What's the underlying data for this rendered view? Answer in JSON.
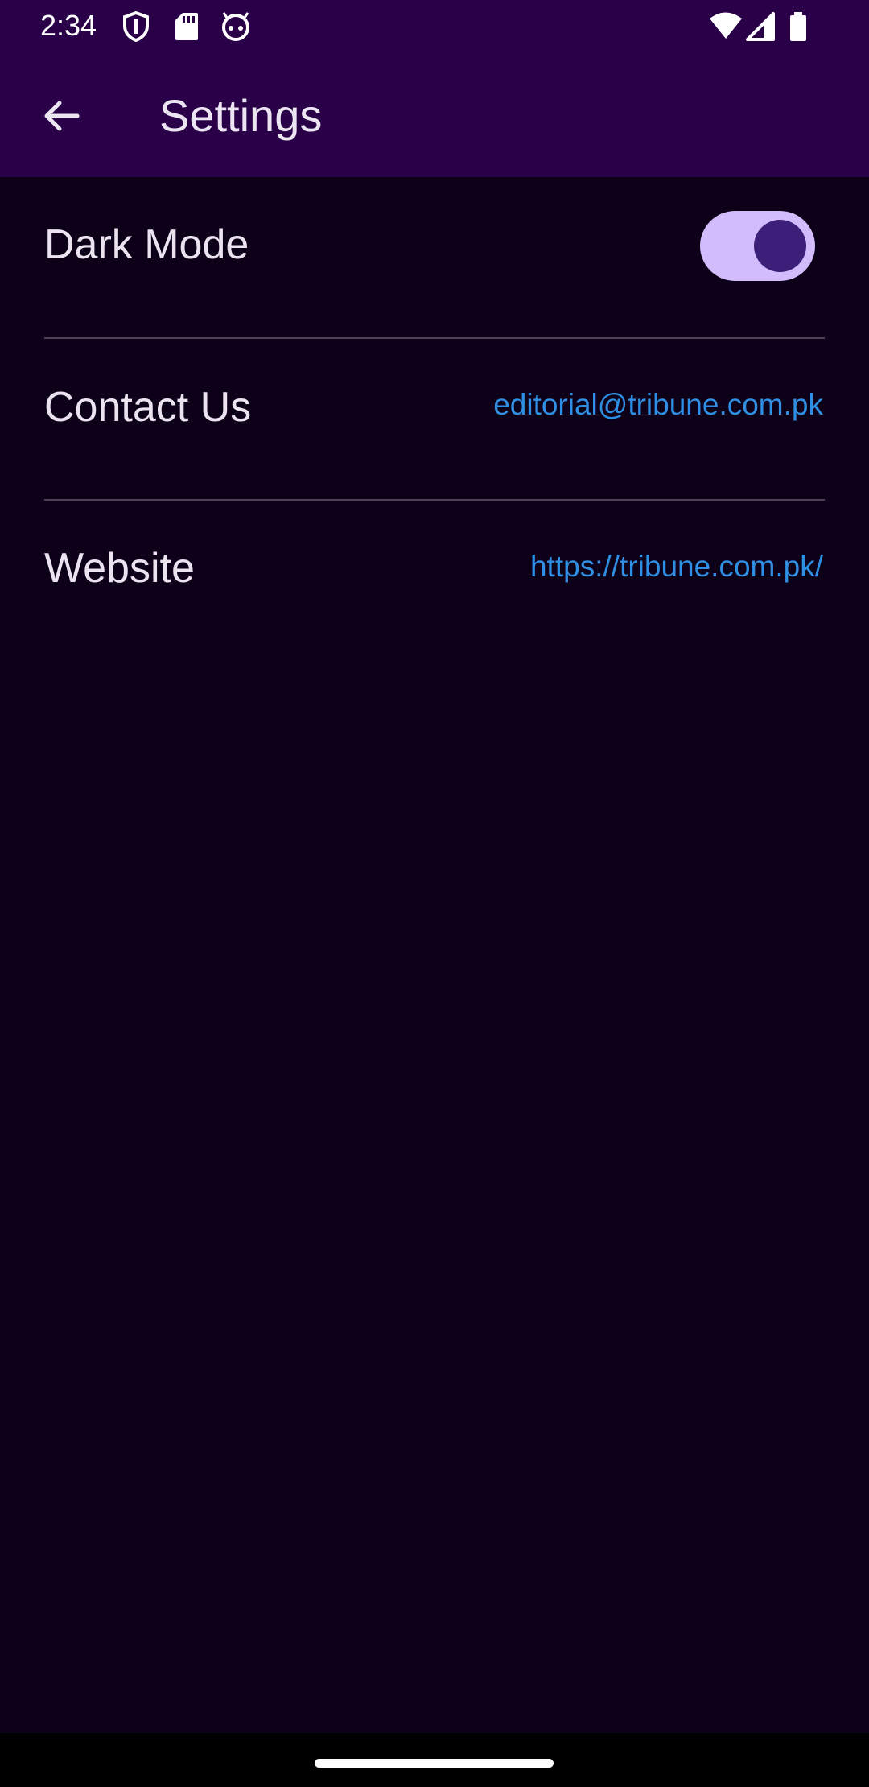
{
  "status_bar": {
    "time": "2:34",
    "left_icons": [
      "shield-icon",
      "sd-card-icon",
      "robot-face-icon"
    ],
    "right_icons": [
      "wifi-icon",
      "signal-icon",
      "battery-icon"
    ]
  },
  "app_bar": {
    "back_icon": "arrow-back-icon",
    "title": "Settings",
    "background": "#2a0148"
  },
  "settings": {
    "dark_mode": {
      "label": "Dark Mode",
      "enabled": true
    },
    "contact": {
      "label": "Contact Us",
      "value": "editorial@tribune.com.pk"
    },
    "website": {
      "label": "Website",
      "value": "https://tribune.com.pk/"
    }
  },
  "colors": {
    "background": "#0d0019",
    "accent_link": "#2f8fe3",
    "toggle_track": "#d3bcfb",
    "toggle_knob": "#3b1f78"
  }
}
